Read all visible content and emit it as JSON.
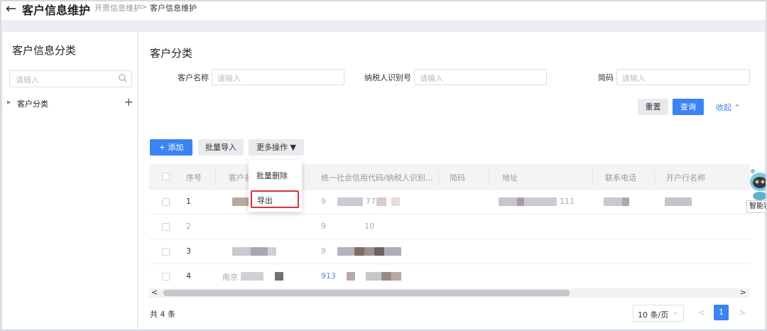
{
  "header": {
    "back_icon": "arrow-left-icon",
    "title": "客户信息维护",
    "breadcrumb": [
      "开票信息维护",
      "客户信息维护"
    ],
    "breadcrumb_separator": ">"
  },
  "sidebar": {
    "title": "客户信息分类",
    "search_placeholder": "请输入",
    "tree": [
      {
        "label": "客户分类",
        "add_symbol": "+"
      }
    ]
  },
  "main": {
    "section_title": "客户分类",
    "filters": [
      {
        "label": "客户名称",
        "placeholder": "请输入"
      },
      {
        "label": "纳税人识别号",
        "placeholder": "请输入"
      },
      {
        "label": "简码",
        "placeholder": "请输入"
      }
    ],
    "reset_label": "重置",
    "query_label": "查询",
    "collapse_label": "收起",
    "toolbar": {
      "add_label": "+ 添加",
      "import_label": "批量导入",
      "more_label": "更多操作 ▼"
    },
    "more_menu": [
      "批量删除",
      "导出"
    ],
    "table": {
      "columns": [
        "序号",
        "客户名",
        "统一社会信用代码/纳税人识别...",
        "简码",
        "地址",
        "联系电话",
        "开户行名称"
      ],
      "rows": [
        {
          "index": "1",
          "name_fragment": "中",
          "code_fragment": "9",
          "code_suffix": "77",
          "addr_fragment": "111"
        },
        {
          "index": "2",
          "name_fragment": "",
          "code_fragment": "9",
          "code_suffix": "10",
          "addr_fragment": ""
        },
        {
          "index": "3",
          "name_fragment": "",
          "code_fragment": "9",
          "code_suffix": "",
          "addr_fragment": ""
        },
        {
          "index": "4",
          "name_fragment": "南京",
          "code_fragment": "913",
          "code_suffix": "",
          "addr_fragment": ""
        }
      ]
    },
    "scroll_left": "<",
    "scroll_right": ">",
    "total_text": "共 4 条",
    "page_size": "10 条/页",
    "current_page": "1",
    "prev_symbol": "<",
    "next_symbol": ">"
  },
  "assistant": {
    "label": "智能客服",
    "icon": "robot-mascot-icon"
  },
  "colors": {
    "primary": "#3a84f5",
    "highlight_border": "#e03040"
  }
}
